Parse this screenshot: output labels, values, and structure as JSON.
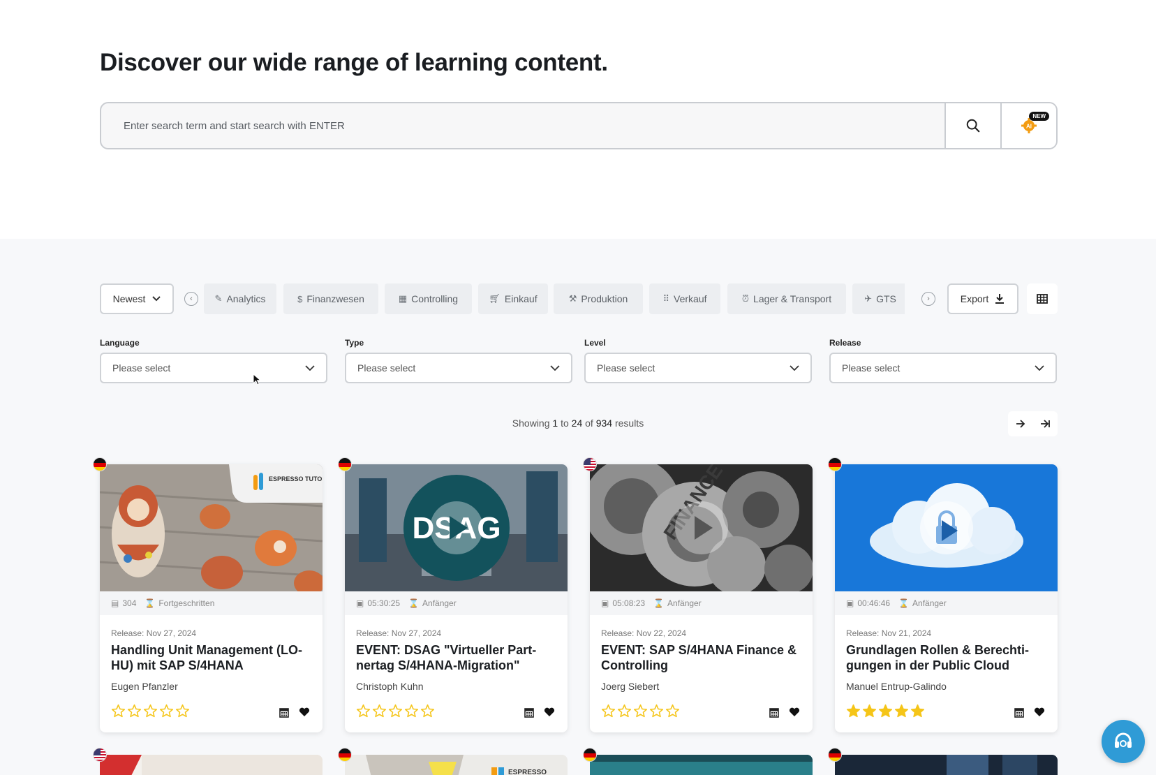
{
  "hero": {
    "title": "Discover our wide range of learning content.",
    "search_placeholder": "Enter search term and start search with ENTER",
    "ai_badge": "NEW",
    "ai_label": "AI"
  },
  "toolbar": {
    "sort_label": "Newest",
    "categories": [
      "Analytics",
      "Finanzwesen",
      "Controlling",
      "Einkauf",
      "Produktion",
      "Verkauf",
      "Lager & Transport",
      "GTS"
    ],
    "category_icons": [
      "pencil-icon",
      "dollar-icon",
      "calculator-icon",
      "cart-icon",
      "hammer-icon",
      "grid-dots-icon",
      "alarm-icon",
      "plane-icon"
    ],
    "export_label": "Export"
  },
  "filters": [
    {
      "label": "Language",
      "value": "Please select"
    },
    {
      "label": "Type",
      "value": "Please select"
    },
    {
      "label": "Level",
      "value": "Please select"
    },
    {
      "label": "Release",
      "value": "Please select"
    }
  ],
  "results": {
    "prefix": "Showing",
    "from": "1",
    "to_word": "to",
    "to": "24",
    "of_word": "of",
    "total": "934",
    "suffix": "results"
  },
  "cards": [
    {
      "flag": "de",
      "meta_1": "304",
      "meta_1_icon": "book-icon",
      "meta_2": "Fortgeschritten",
      "release": "Release: Nov 27, 2024",
      "title": "Handling Unit Management (LO-HU) mit SAP S/4HANA",
      "author": "Eugen Pfanzler",
      "rating": 0,
      "brand": "ESPRESSO TUTORIALS"
    },
    {
      "flag": "de",
      "meta_1": "05:30:25",
      "meta_1_icon": "film-icon",
      "meta_2": "Anfänger",
      "release": "Release: Nov 27, 2024",
      "title": "EVENT: DSAG \"Virtueller Part-nertag S/4HANA-Migration\"",
      "author": "Christoph Kuhn",
      "rating": 0,
      "brand": "DSAG"
    },
    {
      "flag": "us",
      "meta_1": "05:08:23",
      "meta_1_icon": "film-icon",
      "meta_2": "Anfänger",
      "release": "Release: Nov 22, 2024",
      "title": "EVENT: SAP S/4HANA Finance & Controlling",
      "author": "Joerg Siebert",
      "rating": 0,
      "brand": "FINANCE"
    },
    {
      "flag": "de",
      "meta_1": "00:46:46",
      "meta_1_icon": "film-icon",
      "meta_2": "Anfänger",
      "release": "Release: Nov 21, 2024",
      "title": "Grundlagen Rollen & Berechti-gungen in der Public Cloud",
      "author": "Manuel Entrup-Galindo",
      "rating": 5,
      "brand": ""
    }
  ],
  "lower_cards": [
    {
      "flag": "us"
    },
    {
      "flag": "de",
      "brand": "ESPRESSO"
    },
    {
      "flag": "de"
    },
    {
      "flag": "de"
    }
  ],
  "colors": {
    "star": "#f5c518",
    "help": "#2f9bd6",
    "accent_orange": "#f39c12"
  }
}
